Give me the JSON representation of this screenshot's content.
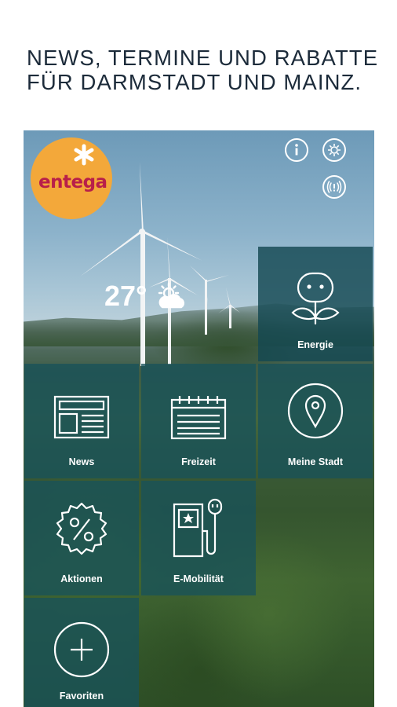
{
  "headline": {
    "line1": "NEWS, TERMINE UND RABATTE",
    "line2": "FÜR DARMSTADT UND MAINZ."
  },
  "app": {
    "logo": {
      "text": "entega",
      "brand_color": "#b81f4a",
      "badge_color": "#f3a83a"
    },
    "top_icons": [
      "info-icon",
      "settings-icon",
      "signal-icon"
    ],
    "weather": {
      "temperature": "27°",
      "icon": "partly-sunny-icon"
    },
    "tiles": [
      {
        "label": "Energie",
        "icon": "energy-flower-icon"
      },
      {
        "label": "News",
        "icon": "newspaper-icon"
      },
      {
        "label": "Freizeit",
        "icon": "calendar-icon"
      },
      {
        "label": "Meine Stadt",
        "icon": "map-pin-icon"
      },
      {
        "label": "Aktionen",
        "icon": "percent-badge-icon"
      },
      {
        "label": "E-Mobilität",
        "icon": "charging-station-icon"
      },
      {
        "label": "Favoriten",
        "icon": "plus-icon"
      }
    ]
  }
}
